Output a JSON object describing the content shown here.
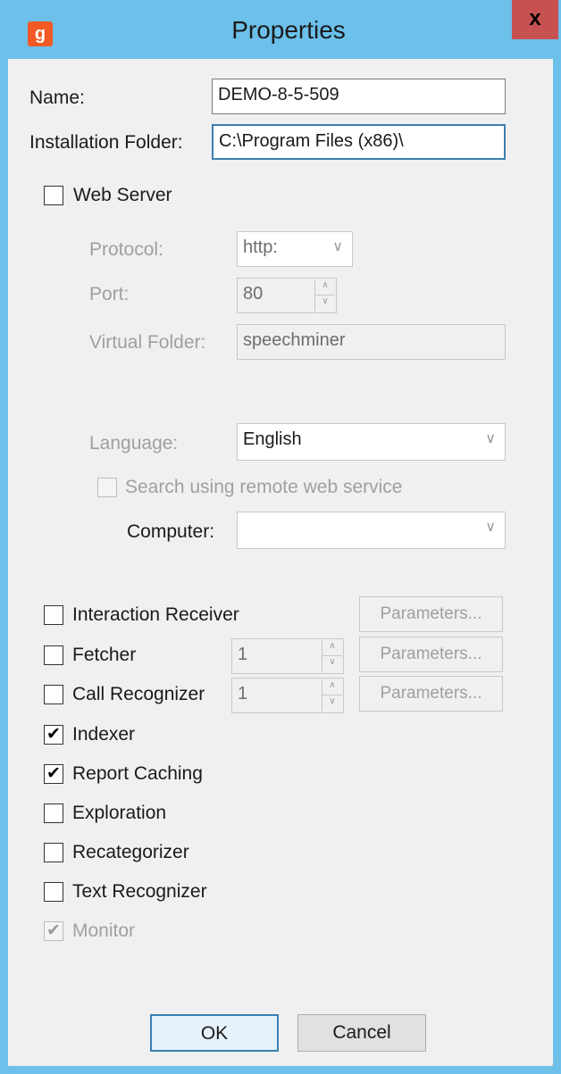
{
  "window": {
    "title": "Properties",
    "close_label": "x",
    "icon_glyph": "g"
  },
  "form": {
    "name_label": "Name:",
    "name_value": "DEMO-8-5-509",
    "install_label": "Installation Folder:",
    "install_value": "C:\\Program Files (x86)\\"
  },
  "web_server": {
    "label": "Web Server",
    "checked": false,
    "protocol_label": "Protocol:",
    "protocol_value": "http:",
    "port_label": "Port:",
    "port_value": "80",
    "virtual_folder_label": "Virtual Folder:",
    "virtual_folder_value": "speechminer",
    "language_label": "Language:",
    "language_value": "English",
    "search_remote_label": "Search using remote web service",
    "computer_label": "Computer:",
    "computer_value": ""
  },
  "components": [
    {
      "label": "Interaction Receiver",
      "checked": false,
      "disabled": false,
      "parameters_label": "Parameters..."
    },
    {
      "label": "Fetcher",
      "checked": false,
      "disabled": false,
      "spin_value": "1",
      "parameters_label": "Parameters..."
    },
    {
      "label": "Call Recognizer",
      "checked": false,
      "disabled": false,
      "spin_value": "1",
      "parameters_label": "Parameters..."
    },
    {
      "label": "Indexer",
      "checked": true,
      "disabled": false
    },
    {
      "label": "Report Caching",
      "checked": true,
      "disabled": false
    },
    {
      "label": "Exploration",
      "checked": false,
      "disabled": false
    },
    {
      "label": "Recategorizer",
      "checked": false,
      "disabled": false
    },
    {
      "label": "Text Recognizer",
      "checked": false,
      "disabled": false
    },
    {
      "label": "Monitor",
      "checked": true,
      "disabled": true
    }
  ],
  "buttons": {
    "ok": "OK",
    "cancel": "Cancel"
  },
  "check_glyph": "✔",
  "colors": {
    "titlebar": "#6cc0ea",
    "close": "#c75050",
    "app_icon": "#f15a24",
    "focus_border": "#3c7fb1"
  }
}
